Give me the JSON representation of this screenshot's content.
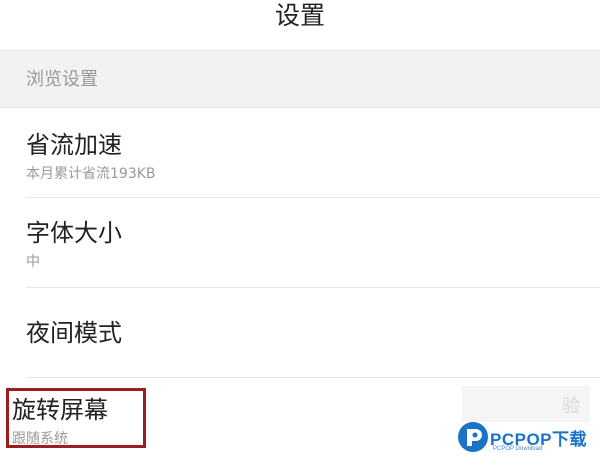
{
  "header": {
    "title": "设置"
  },
  "section": {
    "title": "浏览设置"
  },
  "items": [
    {
      "title": "省流加速",
      "subtitle": "本月累计省流193KB"
    },
    {
      "title": "字体大小",
      "subtitle": "中"
    },
    {
      "title": "夜间模式",
      "subtitle": ""
    },
    {
      "title": "旋转屏幕",
      "subtitle": "跟随系统"
    }
  ],
  "overlay": {
    "partial_text": "验",
    "watermark_brand": "PCPOP下载",
    "watermark_sub": "PCPOP Download",
    "highlight_color": "#9e1c1c",
    "brand_color": "#1a73c9"
  }
}
